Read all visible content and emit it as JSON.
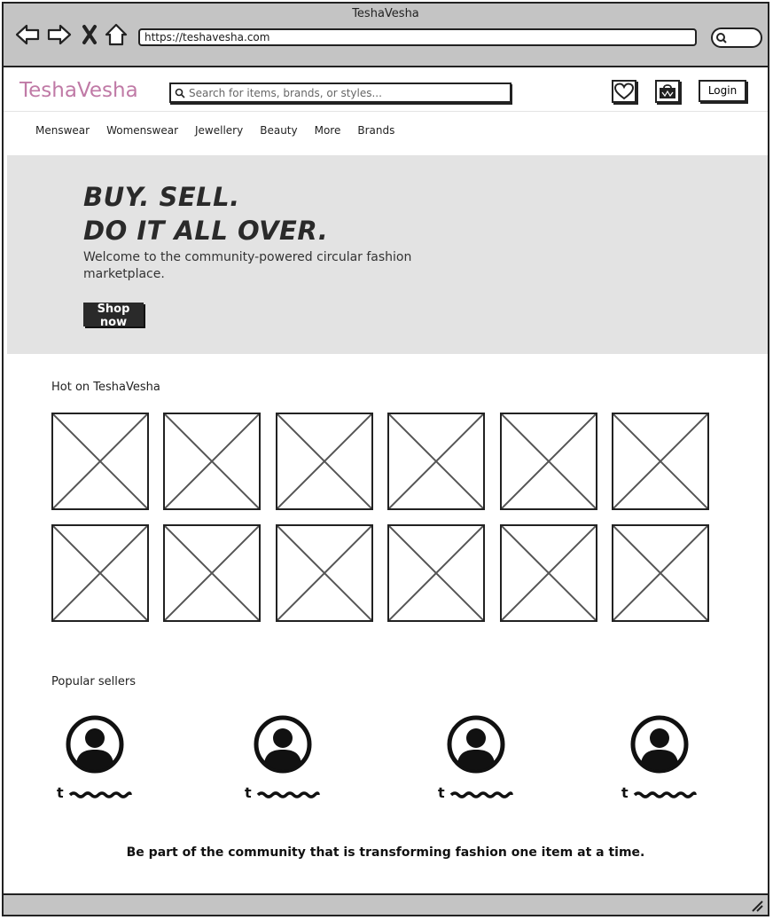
{
  "browser": {
    "window_title": "TeshaVesha",
    "url": "https://teshavesha.com"
  },
  "header": {
    "logo": "TeshaVesha",
    "logo_color": "#c07aa6",
    "search_placeholder": "Search for items, brands, or styles...",
    "login_label": "Login",
    "icons": [
      "heart-icon",
      "shopping-bag-icon"
    ]
  },
  "menu": [
    "Menswear",
    "Womenswear",
    "Jewellery",
    "Beauty",
    "More",
    "Brands"
  ],
  "hero": {
    "headline_1": "BUY. SELL.",
    "headline_2": "DO IT ALL OVER.",
    "subtext": "Welcome to the community-powered circular fashion marketplace.",
    "cta_label": "Shop now"
  },
  "hot": {
    "title": "Hot on TeshaVesha",
    "tile_count": 12
  },
  "sellers": {
    "title": "Popular sellers",
    "items": [
      {
        "initial": "t"
      },
      {
        "initial": "t"
      },
      {
        "initial": "t"
      },
      {
        "initial": "t"
      }
    ]
  },
  "footer": {
    "tagline": "Be part of the community that is transforming fashion one item at a time."
  }
}
